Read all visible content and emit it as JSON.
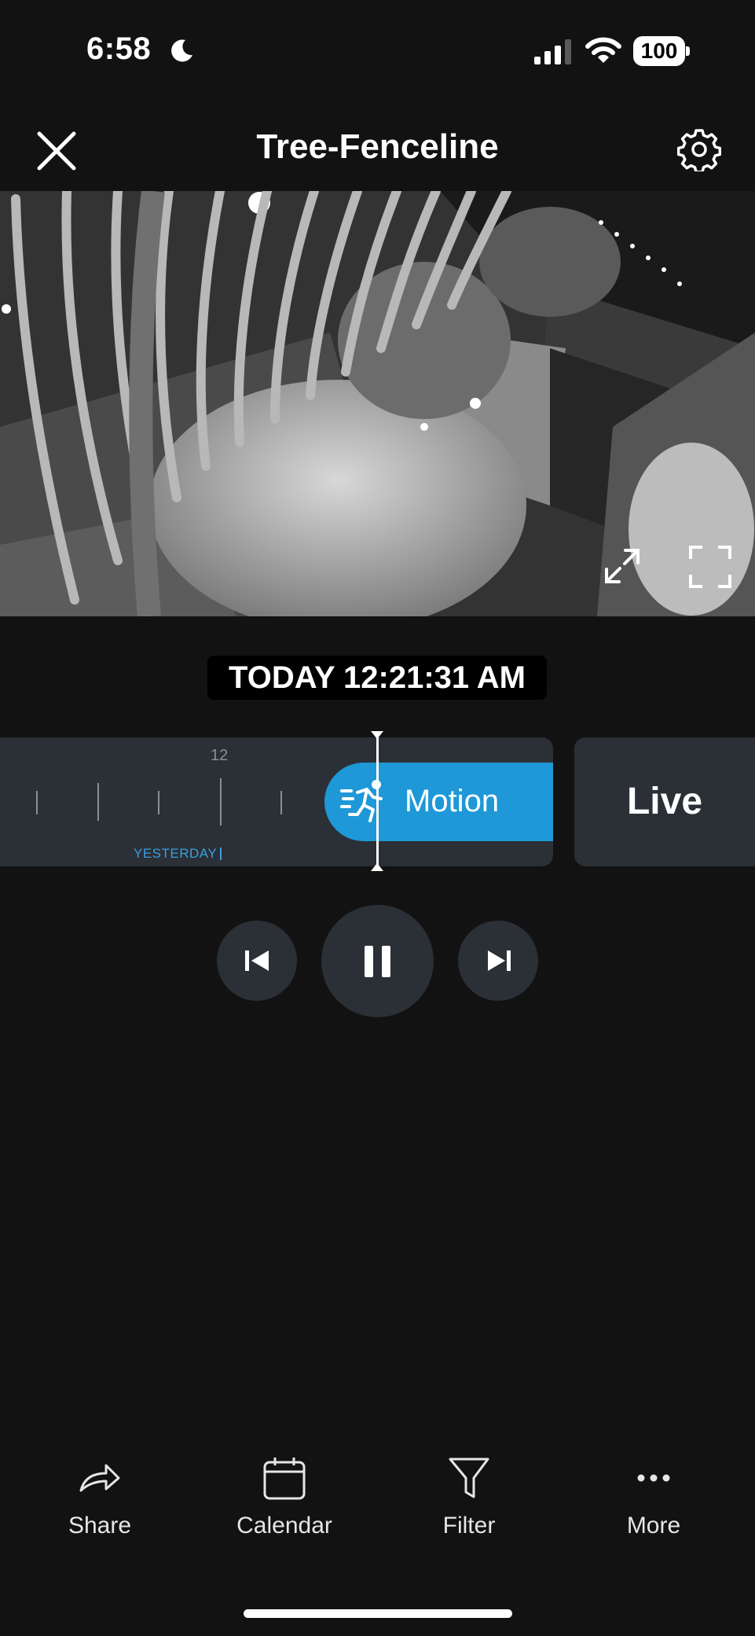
{
  "status_bar": {
    "time": "6:58",
    "battery": "100",
    "icons": [
      "moon-icon",
      "signal-icon",
      "wifi-icon",
      "battery-icon"
    ]
  },
  "header": {
    "title": "Tree-Fenceline",
    "close_icon": "close-icon",
    "settings_icon": "gear-icon"
  },
  "video": {
    "expand_icon": "expand-icon",
    "fullscreen_icon": "fullscreen-icon"
  },
  "timestamp": "TODAY 12:21:31 AM",
  "timeline": {
    "hour_label": "12",
    "day_label": "YESTERDAY",
    "event_label": "Motion",
    "event_icon": "running-person-icon",
    "event_color": "#1e98d7"
  },
  "live_label": "Live",
  "playback": {
    "prev_icon": "skip-previous-icon",
    "pause_icon": "pause-icon",
    "next_icon": "skip-next-icon"
  },
  "toolbar": {
    "items": [
      {
        "label": "Share",
        "icon": "share-icon"
      },
      {
        "label": "Calendar",
        "icon": "calendar-icon"
      },
      {
        "label": "Filter",
        "icon": "filter-icon"
      },
      {
        "label": "More",
        "icon": "more-icon"
      }
    ]
  }
}
